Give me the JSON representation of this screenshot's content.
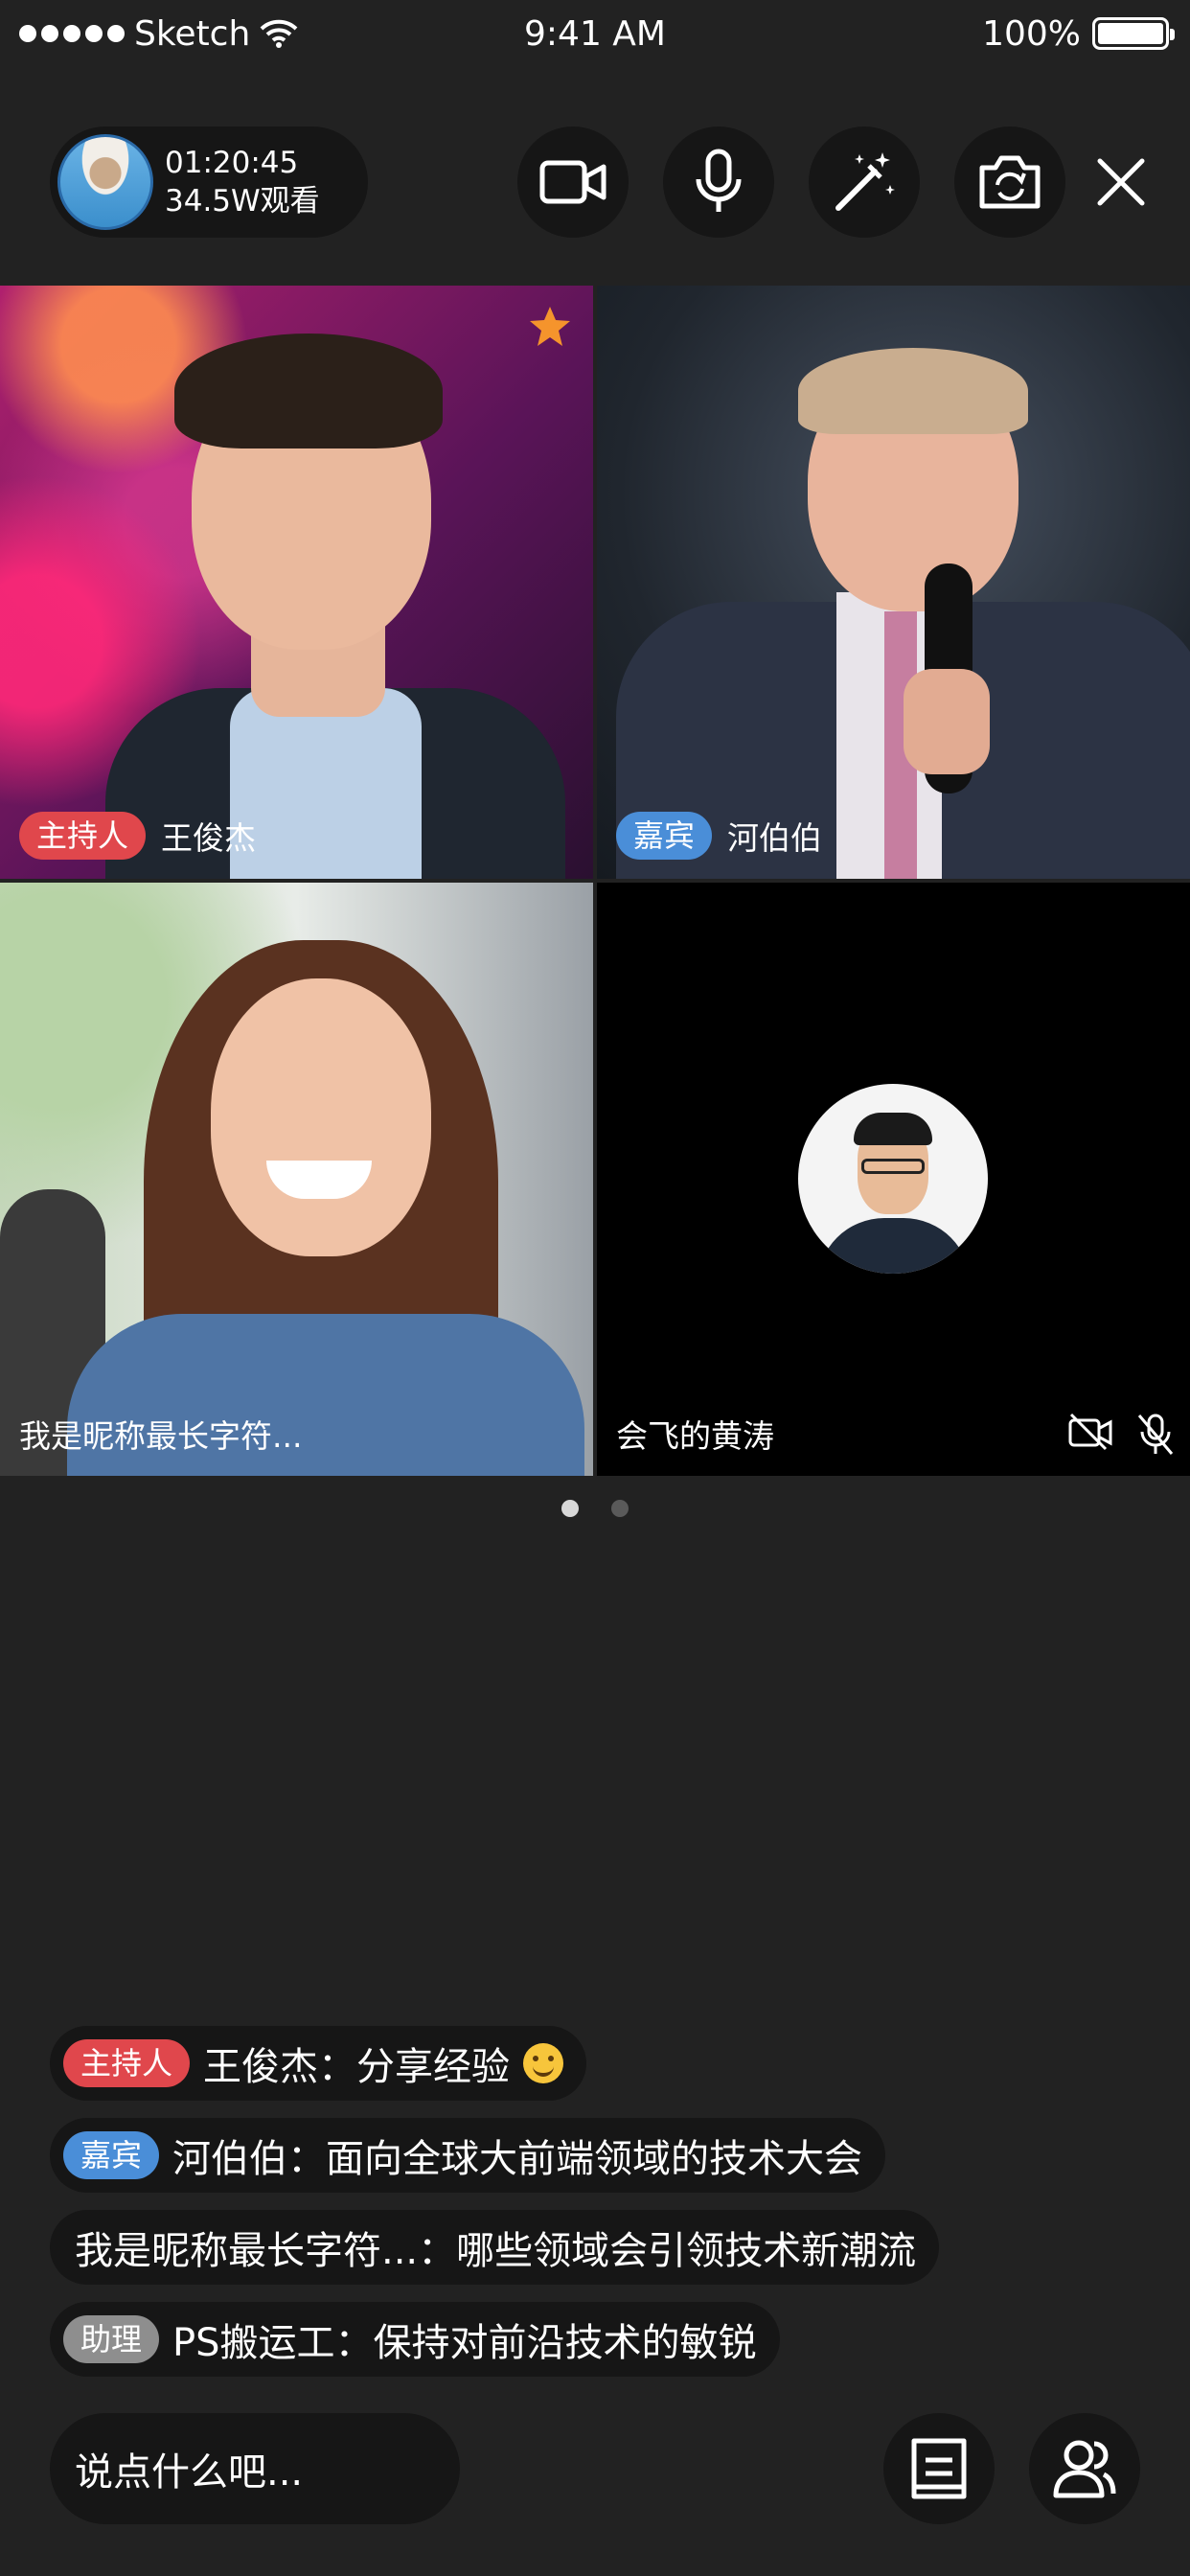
{
  "status_bar": {
    "carrier": "Sketch",
    "time": "9:41 AM",
    "battery": "100%"
  },
  "live_info": {
    "duration": "01:20:45",
    "viewers": "34.5W观看"
  },
  "controls": {
    "camera_icon": "video-camera-icon",
    "mic_icon": "microphone-icon",
    "beauty_icon": "magic-wand-icon",
    "flip_icon": "camera-switch-icon",
    "close_icon": "close-icon"
  },
  "tiles": [
    {
      "role": "主持人",
      "name": "王俊杰",
      "starred": true
    },
    {
      "role": "嘉宾",
      "name": "河伯伯"
    },
    {
      "role": "",
      "name": "我是昵称最长字符..."
    },
    {
      "role": "",
      "name": "会飞的黄涛",
      "camera_off": true,
      "mic_off": true
    }
  ],
  "pager": {
    "count": 2,
    "active": 0
  },
  "chat": [
    {
      "role": "主持人",
      "text": "王俊杰：分享经验"
    },
    {
      "role": "嘉宾",
      "text": "河伯伯：面向全球大前端领域的技术大会"
    },
    {
      "role": "",
      "text": "我是昵称最长字符...：哪些领域会引领技术新潮流"
    },
    {
      "role": "助理",
      "text": "PS搬运工：保持对前沿技术的敏锐"
    }
  ],
  "input": {
    "placeholder": "说点什么吧..."
  },
  "colors": {
    "background": "#222222",
    "pill": "#161616",
    "host_badge": "#e0474c",
    "guest_badge": "#4a8ed8",
    "assistant_badge": "#8e8e8e",
    "star": "#f5942c"
  }
}
